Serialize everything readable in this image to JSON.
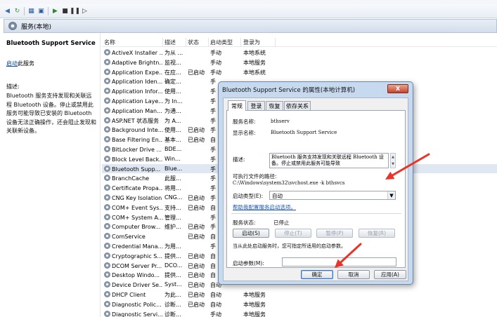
{
  "services_header": {
    "title": "服务(本地)"
  },
  "desc_pane": {
    "service_name": "Bluetooth Support Service",
    "start_link": "启动",
    "start_suffix": "此服务",
    "desc_label": "描述:",
    "desc_text": "Bluetooth 服务支持发现和关联远程 Bluetooth 设备。停止或禁用此服务可能导致已安装的 Bluetooth 设备无法正确操作，还会阻止发现和关联新设备。"
  },
  "columns": [
    "名称",
    "描述",
    "状态",
    "启动类型",
    "登录为"
  ],
  "rows": [
    {
      "name": "ActiveX Installer ...",
      "desc": "为从 ...",
      "status": "",
      "start": "手动",
      "logon": "本地系统"
    },
    {
      "name": "Adaptive Brightn...",
      "desc": "监视...",
      "status": "",
      "start": "手动",
      "logon": "本地服务"
    },
    {
      "name": "Application Expe...",
      "desc": "在应...",
      "status": "已启动",
      "start": "手动",
      "logon": "本地系统"
    },
    {
      "name": "Application Iden...",
      "desc": "确定...",
      "status": "",
      "start": "手",
      "logon": ""
    },
    {
      "name": "Application Infor...",
      "desc": "使用...",
      "status": "",
      "start": "手",
      "logon": ""
    },
    {
      "name": "Application Laye...",
      "desc": "为 In...",
      "status": "",
      "start": "手",
      "logon": ""
    },
    {
      "name": "Application Man...",
      "desc": "为通...",
      "status": "",
      "start": "手",
      "logon": ""
    },
    {
      "name": "ASP.NET 状态服务",
      "desc": "为 A...",
      "status": "",
      "start": "手",
      "logon": ""
    },
    {
      "name": "Background Inte...",
      "desc": "使用...",
      "status": "已启动",
      "start": "手",
      "logon": ""
    },
    {
      "name": "Base Filtering En...",
      "desc": "基本...",
      "status": "已启动",
      "start": "自",
      "logon": ""
    },
    {
      "name": "BitLocker Drive ...",
      "desc": "BDE...",
      "status": "",
      "start": "手",
      "logon": ""
    },
    {
      "name": "Block Level Back...",
      "desc": "Win...",
      "status": "",
      "start": "手",
      "logon": ""
    },
    {
      "name": "Bluetooth Supp...",
      "desc": "Blue...",
      "status": "",
      "start": "手",
      "logon": ""
    },
    {
      "name": "BranchCache",
      "desc": "此服...",
      "status": "",
      "start": "手",
      "logon": ""
    },
    {
      "name": "Certificate Propa...",
      "desc": "将用...",
      "status": "",
      "start": "手",
      "logon": ""
    },
    {
      "name": "CNG Key Isolation",
      "desc": "CNG...",
      "status": "已启动",
      "start": "手",
      "logon": ""
    },
    {
      "name": "COM+ Event Sys...",
      "desc": "支持...",
      "status": "已启动",
      "start": "自",
      "logon": ""
    },
    {
      "name": "COM+ System A...",
      "desc": "管理...",
      "status": "",
      "start": "手",
      "logon": ""
    },
    {
      "name": "Computer Brow...",
      "desc": "维护...",
      "status": "已启动",
      "start": "手",
      "logon": ""
    },
    {
      "name": "ComService",
      "desc": "",
      "status": "已启动",
      "start": "自",
      "logon": ""
    },
    {
      "name": "Credential Mana...",
      "desc": "为用...",
      "status": "",
      "start": "手",
      "logon": ""
    },
    {
      "name": "Cryptographic S...",
      "desc": "提供...",
      "status": "已启动",
      "start": "自",
      "logon": ""
    },
    {
      "name": "DCOM Server Pr...",
      "desc": "DCO...",
      "status": "已启动",
      "start": "自",
      "logon": ""
    },
    {
      "name": "Desktop Windo...",
      "desc": "提供...",
      "status": "已启动",
      "start": "自",
      "logon": ""
    },
    {
      "name": "Device Driver Se...",
      "desc": "Syst...",
      "status": "已启动",
      "start": "自动",
      "logon": ""
    },
    {
      "name": "DHCP Client",
      "desc": "为此...",
      "status": "已启动",
      "start": "自动",
      "logon": "本地服务"
    },
    {
      "name": "Diagnostic Polic...",
      "desc": "诊断...",
      "status": "已启动",
      "start": "自动",
      "logon": "本地服务"
    },
    {
      "name": "Diagnostic Servi...",
      "desc": "诊断...",
      "status": "",
      "start": "手动",
      "logon": "本地服务"
    }
  ],
  "dialog": {
    "title": "Bluetooth Support Service 的属性(本地计算机)",
    "close_label": "X",
    "tabs": [
      "常规",
      "登录",
      "恢复",
      "依存关系"
    ],
    "service_name_label": "服务名称:",
    "service_name_value": "bthserv",
    "display_name_label": "显示名称:",
    "display_name_value": "Bluetooth Support Service",
    "description_label": "描述:",
    "description_value": "Bluetooth 服务支持发现和关联远程 Bluetooth 设备。停止或禁用此服务可能导致",
    "path_label": "可执行文件的路径:",
    "path_value": "C:\\Windows\\system32\\svchost.exe -k bthsvcs",
    "startup_type_label": "启动类型(E):",
    "startup_type_value": "自动",
    "help_link": "帮助我配置服务启动选项。",
    "status_label": "服务状态:",
    "status_value": "已停止",
    "start_button": "启动(S)",
    "stop_button": "停止(T)",
    "pause_button": "暂停(P)",
    "resume_button": "恢复(R)",
    "hint_text": "当从此处启动服务时，您可指定所适用的启动参数。",
    "start_params_label": "启动参数(M):",
    "ok_button": "确定",
    "cancel_button": "取消",
    "apply_button": "应用(A)"
  },
  "colors": {
    "annotation_arrow": "#e8352b",
    "selected_row": "#dfe7f2",
    "link": "#1a56b8"
  }
}
